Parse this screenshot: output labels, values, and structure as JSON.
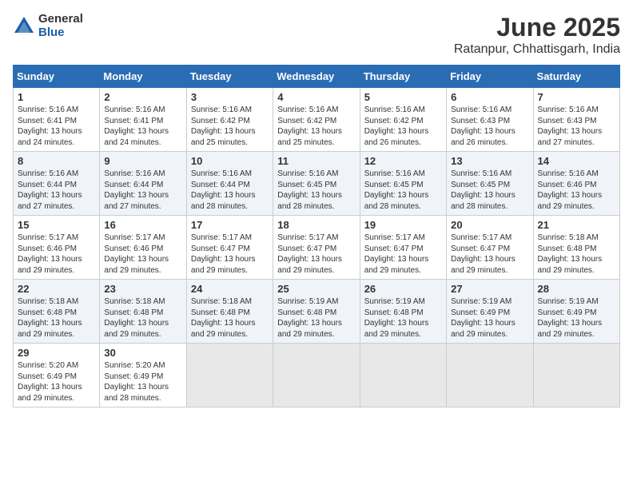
{
  "logo": {
    "general": "General",
    "blue": "Blue"
  },
  "title": "June 2025",
  "location": "Ratanpur, Chhattisgarh, India",
  "days": [
    "Sunday",
    "Monday",
    "Tuesday",
    "Wednesday",
    "Thursday",
    "Friday",
    "Saturday"
  ],
  "weeks": [
    [
      {
        "num": "1",
        "info": "Sunrise: 5:16 AM\nSunset: 6:41 PM\nDaylight: 13 hours\nand 24 minutes."
      },
      {
        "num": "2",
        "info": "Sunrise: 5:16 AM\nSunset: 6:41 PM\nDaylight: 13 hours\nand 24 minutes."
      },
      {
        "num": "3",
        "info": "Sunrise: 5:16 AM\nSunset: 6:42 PM\nDaylight: 13 hours\nand 25 minutes."
      },
      {
        "num": "4",
        "info": "Sunrise: 5:16 AM\nSunset: 6:42 PM\nDaylight: 13 hours\nand 25 minutes."
      },
      {
        "num": "5",
        "info": "Sunrise: 5:16 AM\nSunset: 6:42 PM\nDaylight: 13 hours\nand 26 minutes."
      },
      {
        "num": "6",
        "info": "Sunrise: 5:16 AM\nSunset: 6:43 PM\nDaylight: 13 hours\nand 26 minutes."
      },
      {
        "num": "7",
        "info": "Sunrise: 5:16 AM\nSunset: 6:43 PM\nDaylight: 13 hours\nand 27 minutes."
      }
    ],
    [
      {
        "num": "8",
        "info": "Sunrise: 5:16 AM\nSunset: 6:44 PM\nDaylight: 13 hours\nand 27 minutes."
      },
      {
        "num": "9",
        "info": "Sunrise: 5:16 AM\nSunset: 6:44 PM\nDaylight: 13 hours\nand 27 minutes."
      },
      {
        "num": "10",
        "info": "Sunrise: 5:16 AM\nSunset: 6:44 PM\nDaylight: 13 hours\nand 28 minutes."
      },
      {
        "num": "11",
        "info": "Sunrise: 5:16 AM\nSunset: 6:45 PM\nDaylight: 13 hours\nand 28 minutes."
      },
      {
        "num": "12",
        "info": "Sunrise: 5:16 AM\nSunset: 6:45 PM\nDaylight: 13 hours\nand 28 minutes."
      },
      {
        "num": "13",
        "info": "Sunrise: 5:16 AM\nSunset: 6:45 PM\nDaylight: 13 hours\nand 28 minutes."
      },
      {
        "num": "14",
        "info": "Sunrise: 5:16 AM\nSunset: 6:46 PM\nDaylight: 13 hours\nand 29 minutes."
      }
    ],
    [
      {
        "num": "15",
        "info": "Sunrise: 5:17 AM\nSunset: 6:46 PM\nDaylight: 13 hours\nand 29 minutes."
      },
      {
        "num": "16",
        "info": "Sunrise: 5:17 AM\nSunset: 6:46 PM\nDaylight: 13 hours\nand 29 minutes."
      },
      {
        "num": "17",
        "info": "Sunrise: 5:17 AM\nSunset: 6:47 PM\nDaylight: 13 hours\nand 29 minutes."
      },
      {
        "num": "18",
        "info": "Sunrise: 5:17 AM\nSunset: 6:47 PM\nDaylight: 13 hours\nand 29 minutes."
      },
      {
        "num": "19",
        "info": "Sunrise: 5:17 AM\nSunset: 6:47 PM\nDaylight: 13 hours\nand 29 minutes."
      },
      {
        "num": "20",
        "info": "Sunrise: 5:17 AM\nSunset: 6:47 PM\nDaylight: 13 hours\nand 29 minutes."
      },
      {
        "num": "21",
        "info": "Sunrise: 5:18 AM\nSunset: 6:48 PM\nDaylight: 13 hours\nand 29 minutes."
      }
    ],
    [
      {
        "num": "22",
        "info": "Sunrise: 5:18 AM\nSunset: 6:48 PM\nDaylight: 13 hours\nand 29 minutes."
      },
      {
        "num": "23",
        "info": "Sunrise: 5:18 AM\nSunset: 6:48 PM\nDaylight: 13 hours\nand 29 minutes."
      },
      {
        "num": "24",
        "info": "Sunrise: 5:18 AM\nSunset: 6:48 PM\nDaylight: 13 hours\nand 29 minutes."
      },
      {
        "num": "25",
        "info": "Sunrise: 5:19 AM\nSunset: 6:48 PM\nDaylight: 13 hours\nand 29 minutes."
      },
      {
        "num": "26",
        "info": "Sunrise: 5:19 AM\nSunset: 6:48 PM\nDaylight: 13 hours\nand 29 minutes."
      },
      {
        "num": "27",
        "info": "Sunrise: 5:19 AM\nSunset: 6:49 PM\nDaylight: 13 hours\nand 29 minutes."
      },
      {
        "num": "28",
        "info": "Sunrise: 5:19 AM\nSunset: 6:49 PM\nDaylight: 13 hours\nand 29 minutes."
      }
    ],
    [
      {
        "num": "29",
        "info": "Sunrise: 5:20 AM\nSunset: 6:49 PM\nDaylight: 13 hours\nand 29 minutes."
      },
      {
        "num": "30",
        "info": "Sunrise: 5:20 AM\nSunset: 6:49 PM\nDaylight: 13 hours\nand 28 minutes."
      },
      {
        "num": "",
        "info": ""
      },
      {
        "num": "",
        "info": ""
      },
      {
        "num": "",
        "info": ""
      },
      {
        "num": "",
        "info": ""
      },
      {
        "num": "",
        "info": ""
      }
    ]
  ]
}
